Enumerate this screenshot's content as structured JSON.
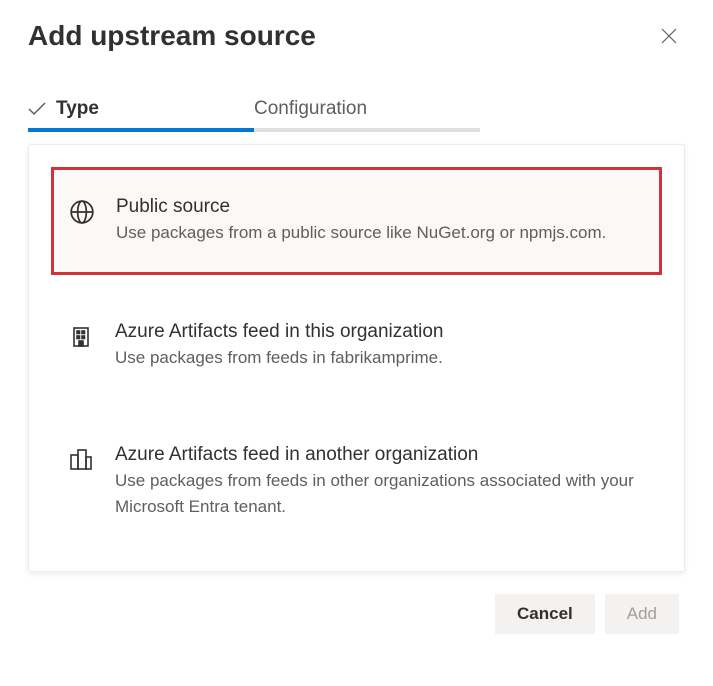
{
  "header": {
    "title": "Add upstream source"
  },
  "tabs": {
    "type": "Type",
    "configuration": "Configuration"
  },
  "options": {
    "public": {
      "title": "Public source",
      "desc": "Use packages from a public source like NuGet.org or npmjs.com."
    },
    "orgFeed": {
      "title": "Azure Artifacts feed in this organization",
      "desc": "Use packages from feeds in fabrikamprime."
    },
    "otherOrgFeed": {
      "title": "Azure Artifacts feed in another organization",
      "desc": "Use packages from feeds in other organizations associated with your Microsoft Entra tenant."
    }
  },
  "footer": {
    "cancel": "Cancel",
    "add": "Add"
  }
}
